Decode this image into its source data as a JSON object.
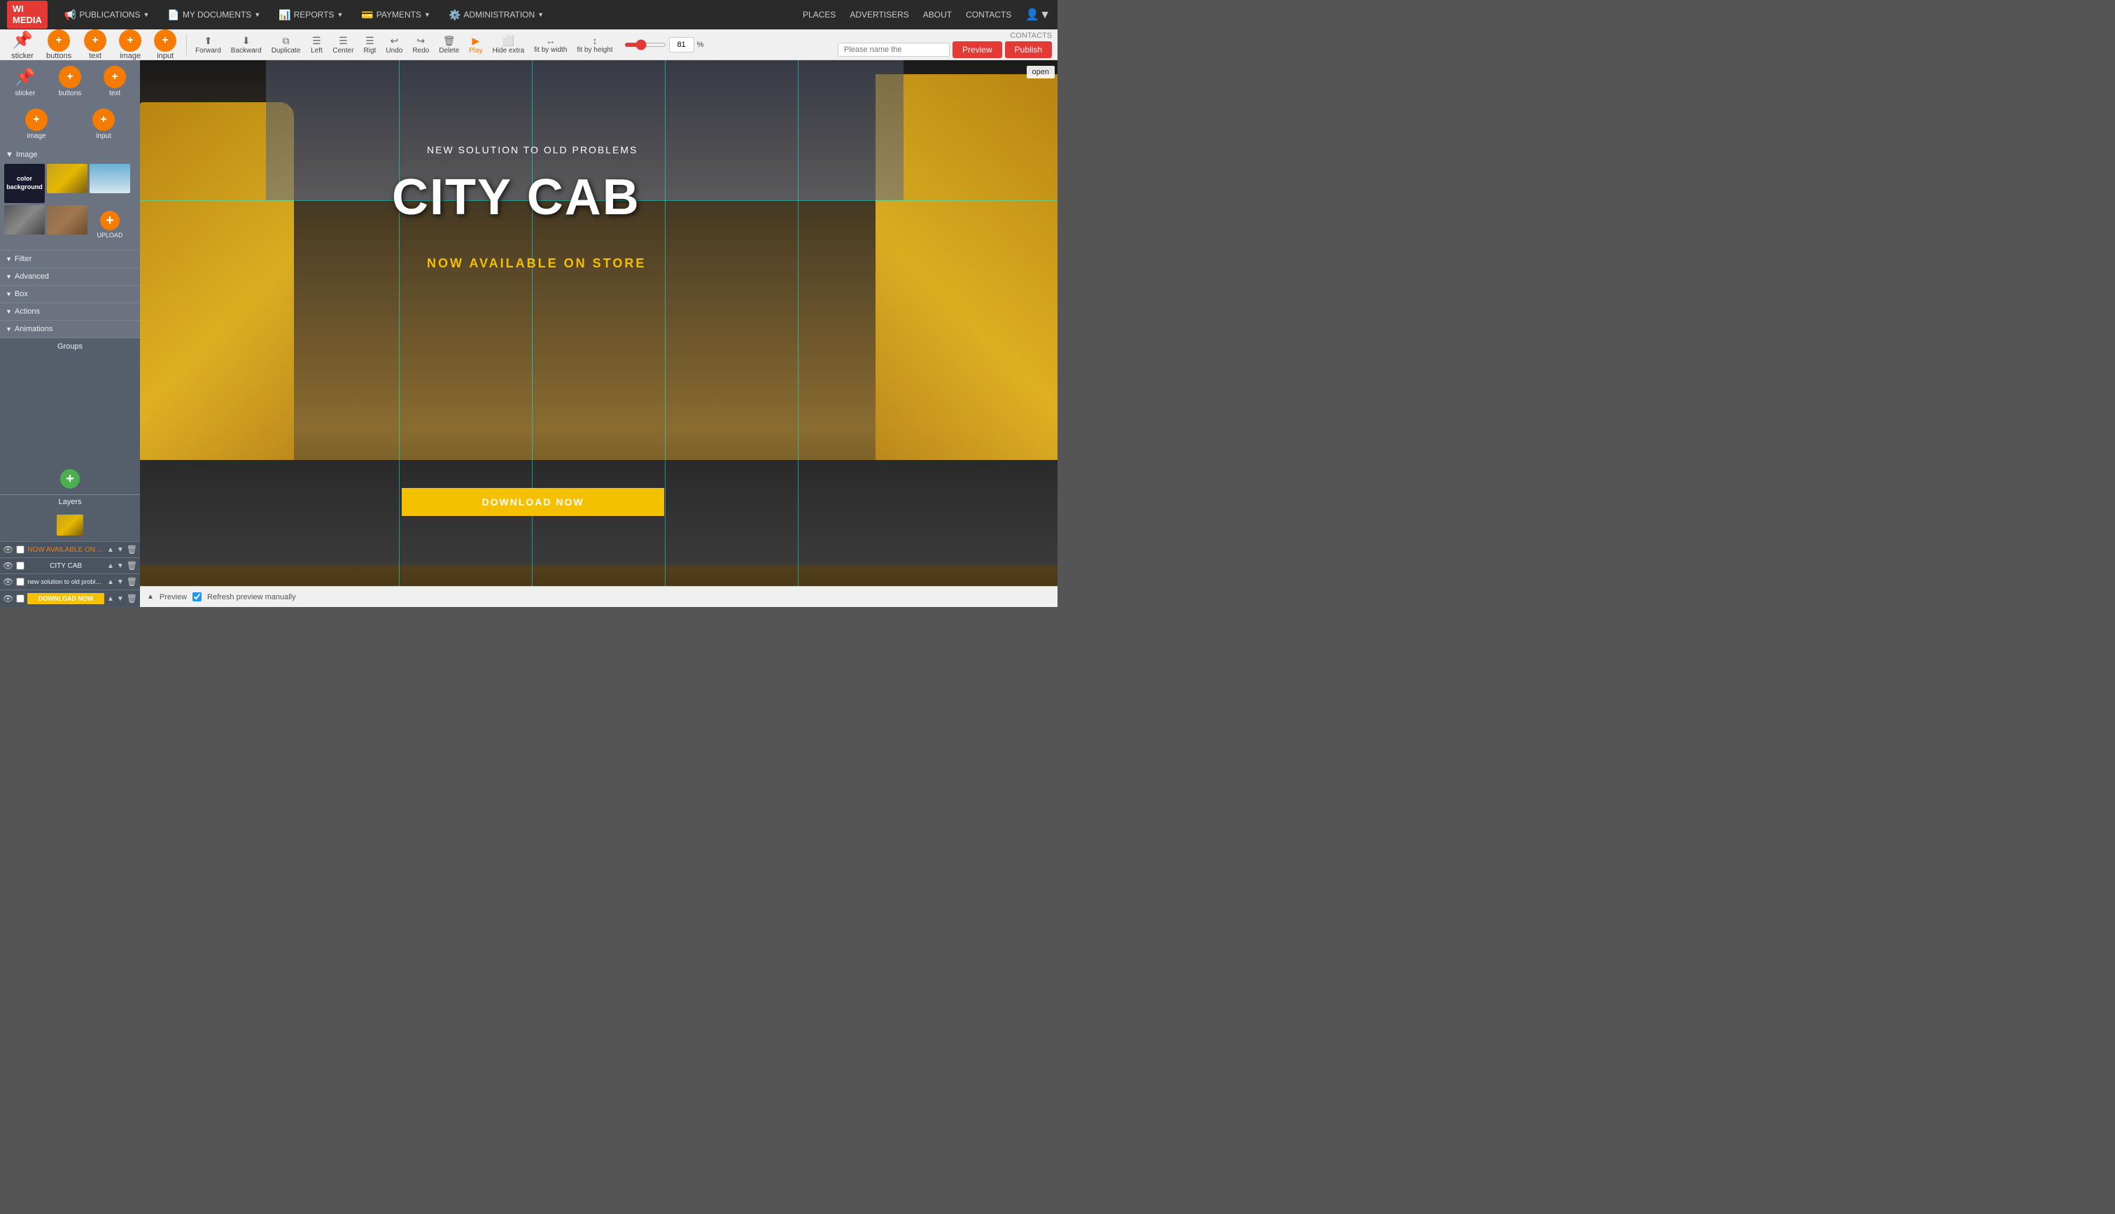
{
  "nav": {
    "logo_line1": "WI",
    "logo_line2": "MEDIA",
    "items": [
      {
        "label": "PUBLICATIONS",
        "icon": "📢"
      },
      {
        "label": "MY DOCUMENTS",
        "icon": "📄"
      },
      {
        "label": "REPORTS",
        "icon": "📊"
      },
      {
        "label": "PAYMENTS",
        "icon": "💳"
      },
      {
        "label": "ADMINISTRATION",
        "icon": "⚙️"
      }
    ],
    "right_items": [
      "PLACES",
      "ADVERTISERS",
      "ABOUT",
      "CONTACTS"
    ]
  },
  "toolbar": {
    "tools": [
      {
        "label": "sticker",
        "icon": "📌"
      },
      {
        "label": "buttons",
        "icon": "+"
      },
      {
        "label": "text",
        "icon": "+"
      },
      {
        "label": "image",
        "icon": "+"
      },
      {
        "label": "input",
        "icon": "+"
      }
    ],
    "actions": [
      {
        "label": "Forward",
        "icon": "⬆"
      },
      {
        "label": "Backward",
        "icon": "⬇"
      },
      {
        "label": "Duplicate",
        "icon": "⧉"
      },
      {
        "label": "Left",
        "icon": "⬛"
      },
      {
        "label": "Center",
        "icon": "⬛"
      },
      {
        "label": "Rigt",
        "icon": "⬛"
      },
      {
        "label": "Undo",
        "icon": "↩"
      },
      {
        "label": "Redo",
        "icon": "↪"
      },
      {
        "label": "Delete",
        "icon": "🗑"
      },
      {
        "label": "Play",
        "icon": "▶"
      },
      {
        "label": "Hide extra",
        "icon": "⬜"
      },
      {
        "label": "fit by width",
        "icon": "↔"
      },
      {
        "label": "fit by height",
        "icon": "↕"
      }
    ],
    "zoom_value": "81",
    "preview_label": "Preview",
    "publish_label": "Publish",
    "please_name_placeholder": "Please name the",
    "contacts_label": "CONTACTS"
  },
  "left_panel": {
    "image_section_label": "Image",
    "color_bg_label": "color background",
    "upload_label": "UPLOAD",
    "filter_label": "Filter",
    "advanced_label": "Advanced",
    "box_label": "Box",
    "actions_label": "Actions",
    "animations_label": "Animations",
    "groups_label": "Groups",
    "layers_label": "Layers"
  },
  "layers": [
    {
      "name": "NOW AVAILABLE ON STORE",
      "color": "orange"
    },
    {
      "name": "CITY CAB",
      "color": "white"
    },
    {
      "name": "new solution to old problems",
      "color": "white"
    },
    {
      "name": "DOWNLOAD NOW",
      "color": "yellow-btn"
    }
  ],
  "canvas": {
    "subtitle": "NEW SOLUTION TO OLD PROBLEMS",
    "title": "CITY CAB",
    "available": "NOW AVAILABLE ON STORE",
    "download_btn": "DOWNLOAD NOW",
    "open_btn": "open"
  },
  "bottom_bar": {
    "preview_label": "Preview",
    "refresh_label": "Refresh preview manually"
  }
}
